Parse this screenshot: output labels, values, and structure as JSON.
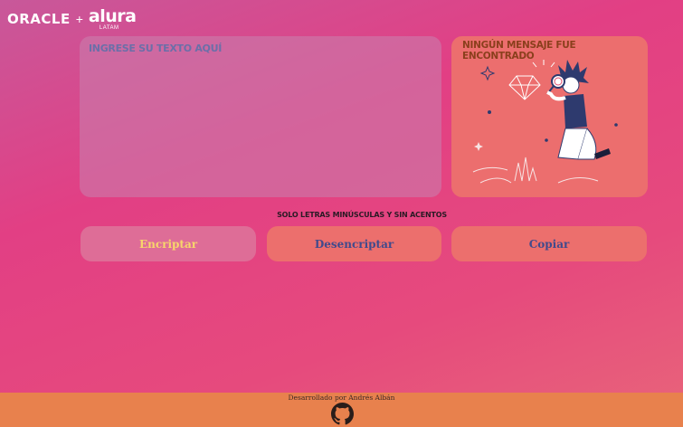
{
  "header": {
    "oracle_logo": "ORACLE",
    "plus_sign": "+",
    "alura_logo": "alura",
    "alura_sub": "LATAM"
  },
  "input": {
    "placeholder": "INGRESE SU TEXTO AQUÍ"
  },
  "output": {
    "title": "NINGÚN MENSAJE FUE ENCONTRADO",
    "illustration": "person-with-magnifying-glass-and-diamond"
  },
  "hint": "SOLO LETRAS MINÚSCULAS Y SIN ACENTOS",
  "buttons": {
    "encrypt": "Encriptar",
    "decrypt": "Desencriptar",
    "copy": "Copiar"
  },
  "footer": {
    "credit": "Desarrollado por Andrés Albán",
    "icon": "github-icon"
  },
  "colors": {
    "encrypt_text": "#f7d66b",
    "button_text": "#414a8c",
    "footer_bg": "#e8814d"
  }
}
